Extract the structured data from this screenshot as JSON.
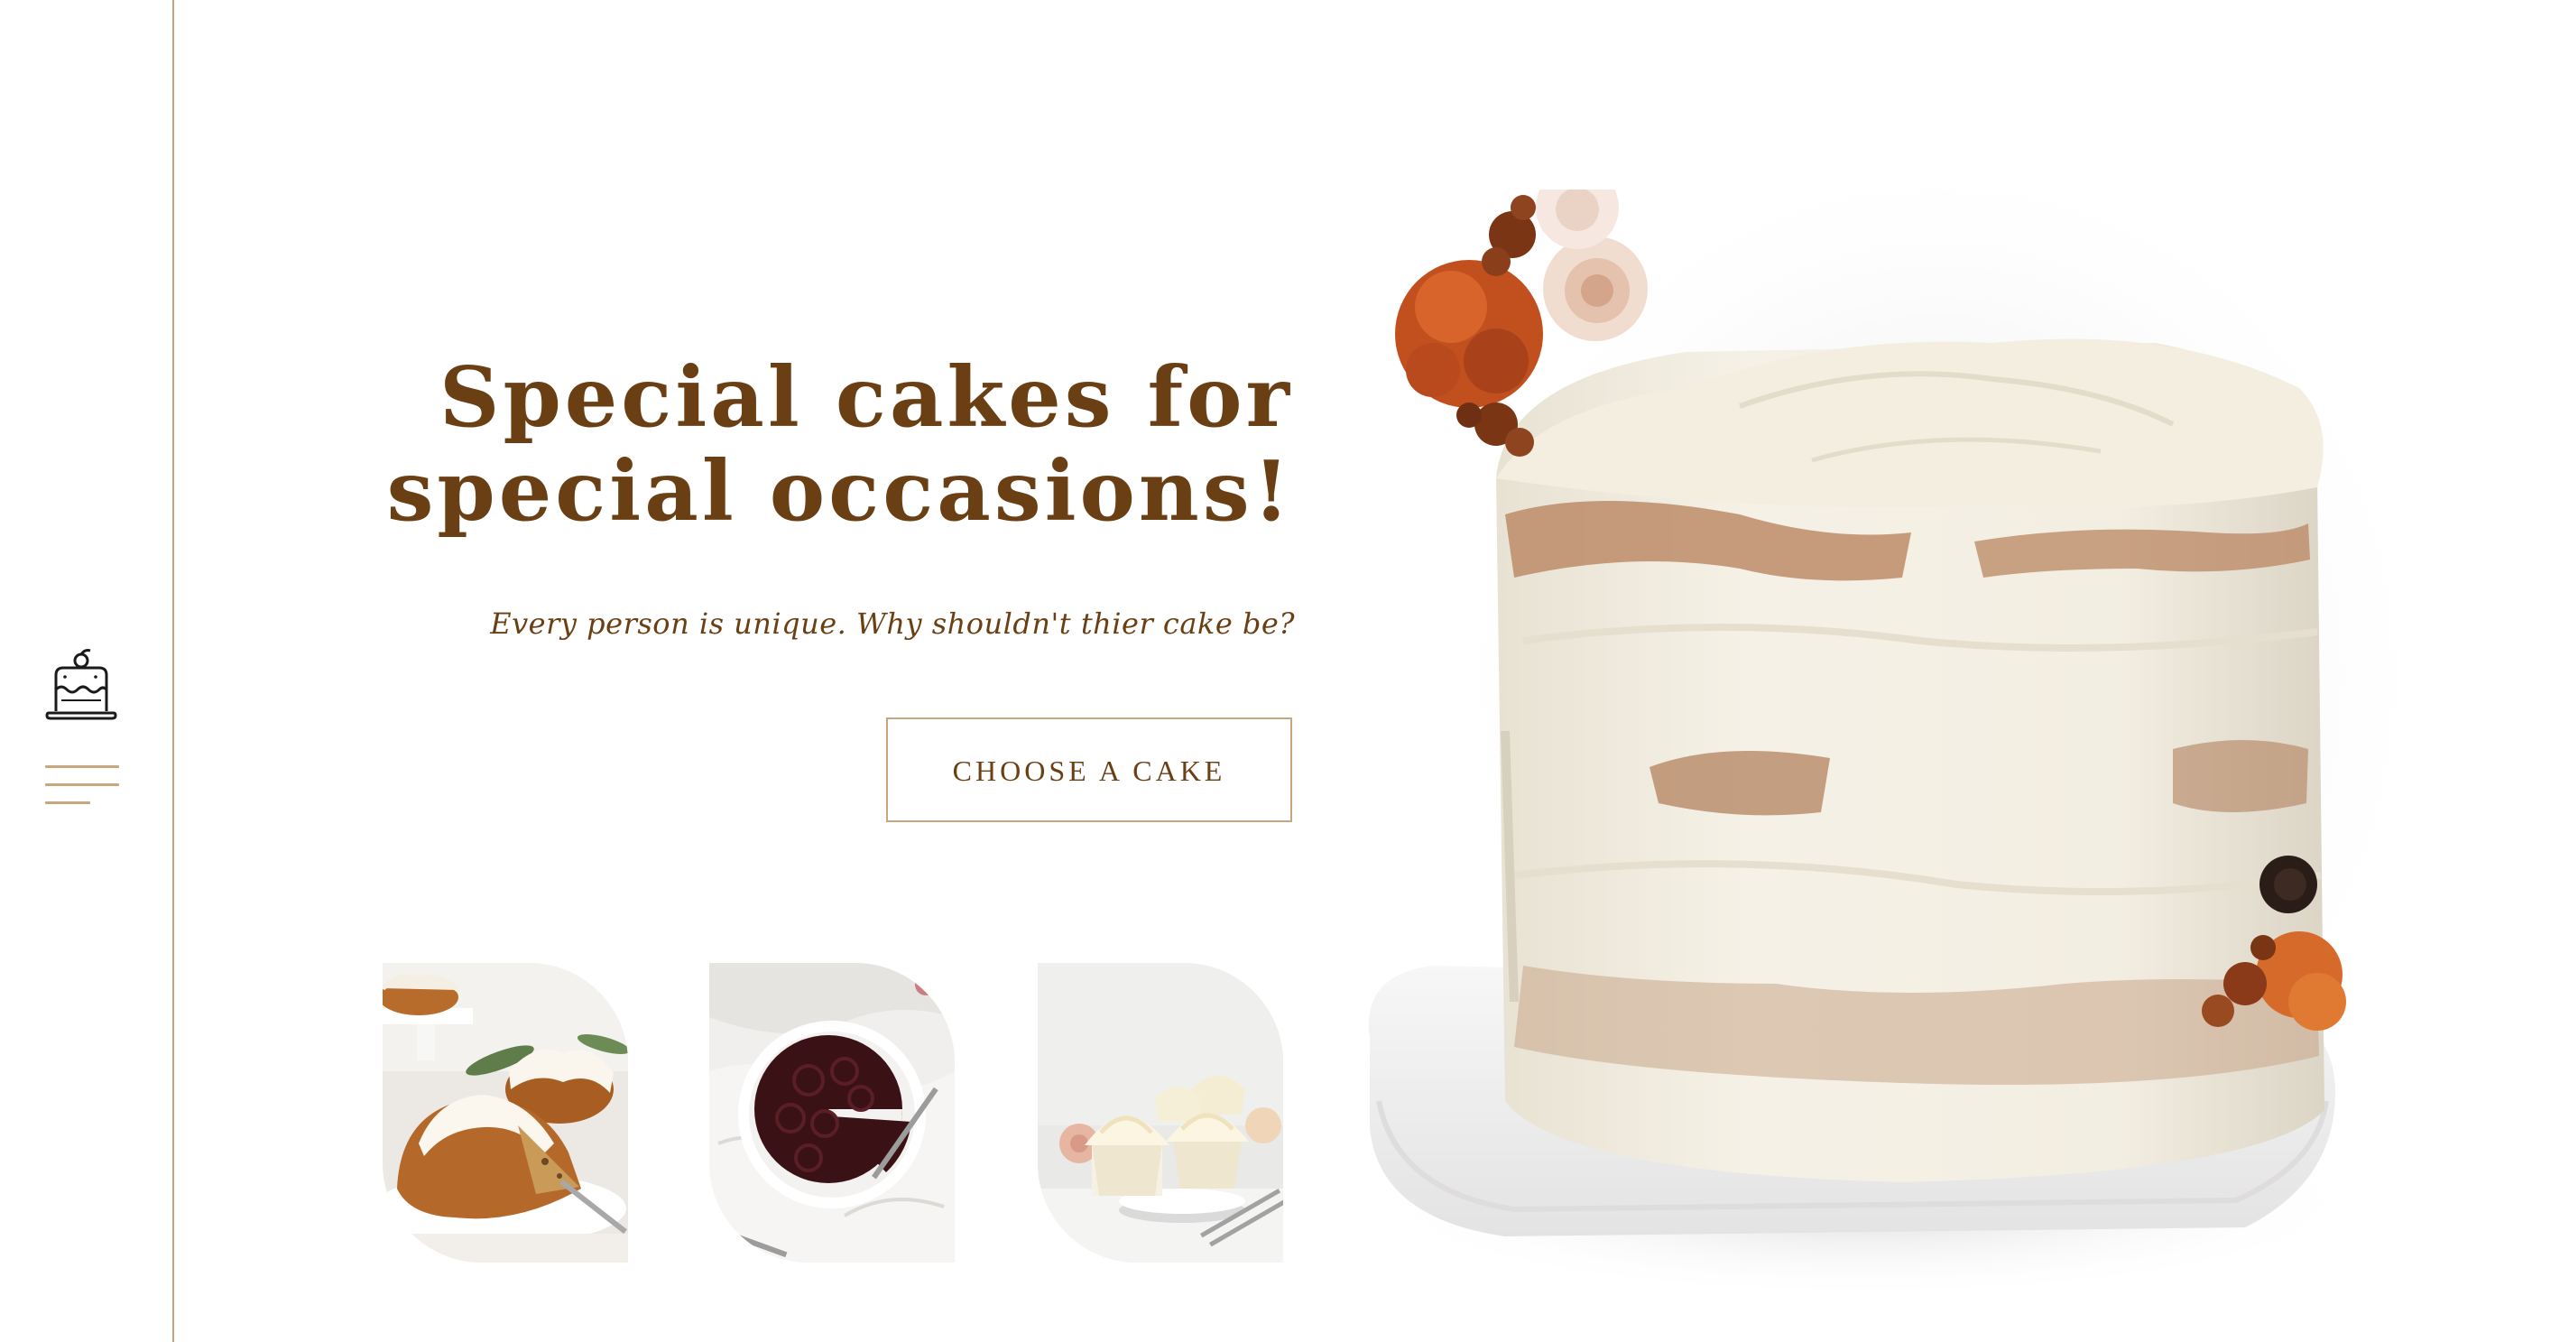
{
  "hero": {
    "headline_line1": "Special cakes for",
    "headline_line2": "special occasions!",
    "tagline": "Every person is unique. Why shouldn't thier cake be?",
    "cta_label": "CHOOSE A CAKE"
  },
  "sidebar": {
    "logo_icon": "cake-icon",
    "menu_icon": "hamburger-menu-icon"
  },
  "gallery": [
    {
      "subject": "bundt-cakes-photo"
    },
    {
      "subject": "chocolate-cake-photo"
    },
    {
      "subject": "cupcakes-photo"
    }
  ],
  "colors": {
    "brand_brown": "#6b3f14",
    "accent_tan": "#c9a77e",
    "background": "#ffffff"
  }
}
